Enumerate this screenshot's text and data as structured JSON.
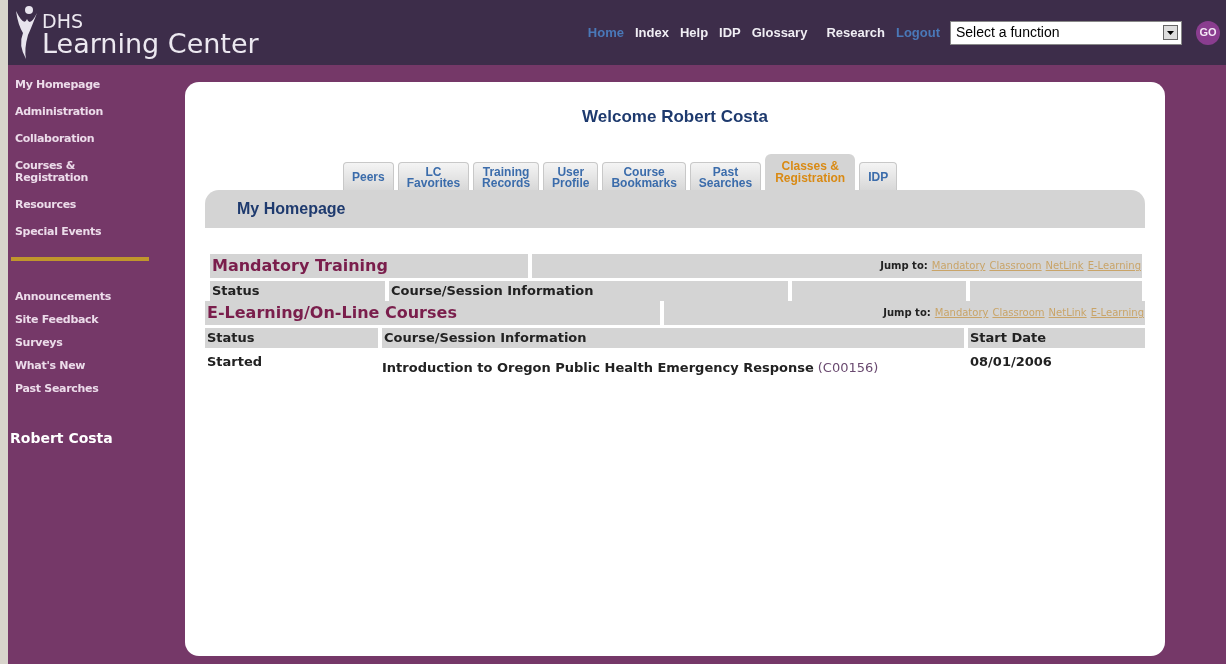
{
  "header": {
    "logo_small": "DHS",
    "logo_large": "Learning Center",
    "nav": [
      {
        "label": "Home",
        "kind": "current"
      },
      {
        "label": "Index",
        "kind": "plain"
      },
      {
        "label": "Help",
        "kind": "plain"
      },
      {
        "label": "IDP",
        "kind": "plain"
      },
      {
        "label": "Glossary",
        "kind": "plain"
      },
      {
        "label": "Research",
        "kind": "plain"
      },
      {
        "label": "Logout",
        "kind": "current"
      }
    ],
    "function_select": {
      "value": "Select a function"
    },
    "go_button": "GO"
  },
  "sidebar": {
    "items": [
      {
        "label": "My Homepage"
      },
      {
        "label": "Administration"
      },
      {
        "label": "Collaboration"
      },
      {
        "label": "Courses &\nRegistration"
      },
      {
        "label": "Resources"
      },
      {
        "label": "Special Events"
      }
    ],
    "secondary_items": [
      {
        "label": "Announcements"
      },
      {
        "label": "Site Feedback"
      },
      {
        "label": "Surveys"
      },
      {
        "label": "What's New"
      },
      {
        "label": "Past Searches"
      }
    ],
    "user_name": "Robert Costa"
  },
  "welcome": "Welcome Robert Costa",
  "tabs": [
    {
      "label": "Peers",
      "selected": false
    },
    {
      "label": "LC\nFavorites",
      "selected": false
    },
    {
      "label": "Training\nRecords",
      "selected": false
    },
    {
      "label": "User\nProfile",
      "selected": false
    },
    {
      "label": "Course\nBookmarks",
      "selected": false
    },
    {
      "label": "Past\nSearches",
      "selected": false
    },
    {
      "label": "Classes &\nRegistration",
      "selected": true
    },
    {
      "label": "IDP",
      "selected": false
    }
  ],
  "page_title": "My Homepage",
  "sections": [
    {
      "title": "Mandatory Training",
      "jump_label": "Jump to:",
      "jump_links": [
        "Mandatory",
        "Classroom",
        "NetLink",
        "E-Learning"
      ],
      "kind": "mandatory",
      "columns": [
        "Status",
        "Course/Session Information"
      ]
    },
    {
      "title": "E-Learning/On-Line Courses",
      "jump_label": "Jump to:",
      "jump_links": [
        "Mandatory",
        "Classroom",
        "NetLink",
        "E-Learning"
      ],
      "kind": "elearning",
      "columns": [
        "Status",
        "Course/Session Information",
        "Start Date"
      ],
      "rows": [
        {
          "status": "Started",
          "course": "Introduction to Oregon Public Health Emergency Response",
          "code": "(C00156)",
          "start_date": "08/01/2006"
        }
      ]
    }
  ]
}
